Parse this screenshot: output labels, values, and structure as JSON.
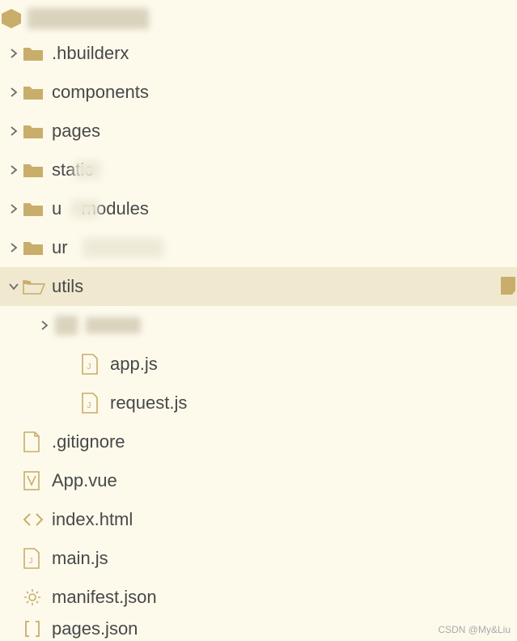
{
  "project": {
    "name_obscured": true
  },
  "tree": {
    "items": [
      {
        "label": ".hbuilderx",
        "icon": "folder",
        "chevron": "right",
        "level": 1
      },
      {
        "label": "components",
        "icon": "folder",
        "chevron": "right",
        "level": 1
      },
      {
        "label": "pages",
        "icon": "folder",
        "chevron": "right",
        "level": 1
      },
      {
        "label": "static",
        "icon": "folder",
        "chevron": "right",
        "level": 1,
        "smudge": true
      },
      {
        "label": "uni_modules",
        "icon": "folder",
        "chevron": "right",
        "level": 1,
        "smudge": true
      },
      {
        "label": "unpackage",
        "icon": "folder",
        "chevron": "right",
        "level": 1,
        "smudge": true
      },
      {
        "label": "utils",
        "icon": "folder-open",
        "chevron": "down",
        "level": 1,
        "selected": true,
        "marker": true
      },
      {
        "label": "",
        "icon": "blur",
        "chevron": "right",
        "level": 2,
        "blur_child": true
      },
      {
        "label": "app.js",
        "icon": "js",
        "chevron": "",
        "level": 3
      },
      {
        "label": "request.js",
        "icon": "js",
        "chevron": "",
        "level": 3
      },
      {
        "label": ".gitignore",
        "icon": "file",
        "chevron": "",
        "level": 1
      },
      {
        "label": "App.vue",
        "icon": "vue",
        "chevron": "",
        "level": 1
      },
      {
        "label": "index.html",
        "icon": "html",
        "chevron": "",
        "level": 1
      },
      {
        "label": "main.js",
        "icon": "js",
        "chevron": "",
        "level": 1
      },
      {
        "label": "manifest.json",
        "icon": "json-gear",
        "chevron": "",
        "level": 1
      },
      {
        "label": "pages.json",
        "icon": "json-bracket",
        "chevron": "",
        "level": 1
      }
    ]
  },
  "watermark": "CSDN @My&Liu"
}
